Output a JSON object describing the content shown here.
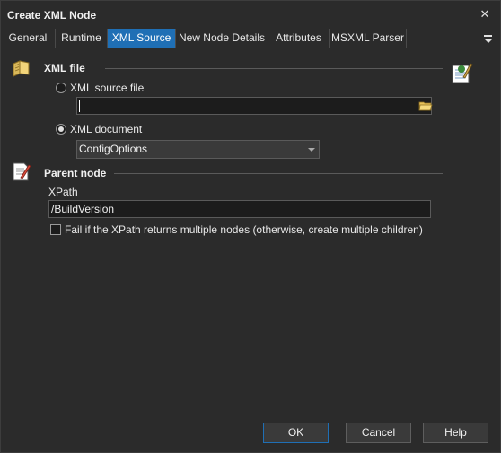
{
  "window": {
    "title": "Create XML Node"
  },
  "tabs": [
    {
      "label": "General"
    },
    {
      "label": "Runtime"
    },
    {
      "label": "XML Source"
    },
    {
      "label": "New Node Details"
    },
    {
      "label": "Attributes"
    },
    {
      "label": "MSXML Parser"
    }
  ],
  "active_tab": "XML Source",
  "xml_file": {
    "section_label": "XML file",
    "source_file_option": {
      "label": "XML source file",
      "selected": false
    },
    "source_file_value": "",
    "document_option": {
      "label": "XML document",
      "selected": true
    },
    "document_value": "ConfigOptions"
  },
  "parent_node": {
    "section_label": "Parent node",
    "xpath_label": "XPath",
    "xpath_value": "/BuildVersion",
    "fail_checkbox": {
      "label": "Fail if the XPath returns multiple nodes (otherwise, create multiple children)",
      "checked": false
    }
  },
  "buttons": {
    "ok": "OK",
    "cancel": "Cancel",
    "help": "Help"
  },
  "colors": {
    "accent": "#1f6fb5",
    "background": "#2b2b2b",
    "field": "#1c1c1c"
  }
}
